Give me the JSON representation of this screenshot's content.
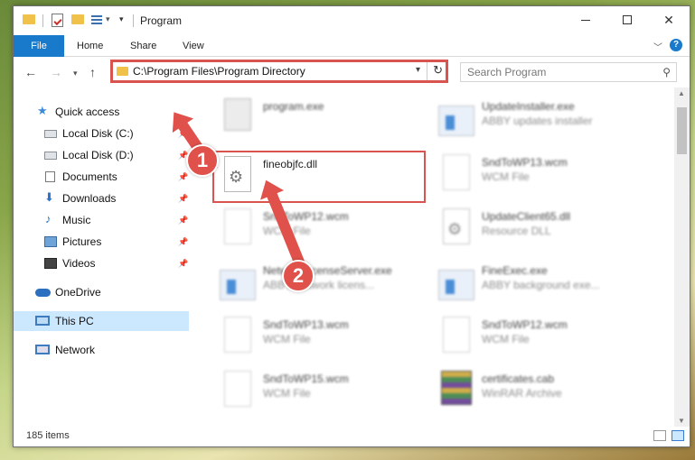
{
  "window": {
    "title": "Program",
    "minimize": "",
    "maximize": "",
    "close": "✕"
  },
  "ribbon": {
    "tabs": [
      "File",
      "Home",
      "Share",
      "View"
    ]
  },
  "address": {
    "path": "C:\\Program Files\\Program Directory",
    "search_placeholder": "Search Program"
  },
  "sidebar": {
    "items": [
      {
        "label": "Quick access",
        "icon": "star-icon",
        "pinned": false
      },
      {
        "label": "Local Disk (C:)",
        "icon": "disk-icon",
        "pinned": true
      },
      {
        "label": "Local Disk (D:)",
        "icon": "disk-icon",
        "pinned": true
      },
      {
        "label": "Documents",
        "icon": "document-icon",
        "pinned": true
      },
      {
        "label": "Downloads",
        "icon": "download-icon",
        "pinned": true
      },
      {
        "label": "Music",
        "icon": "music-icon",
        "pinned": true
      },
      {
        "label": "Pictures",
        "icon": "pictures-icon",
        "pinned": true
      },
      {
        "label": "Videos",
        "icon": "videos-icon",
        "pinned": true
      },
      {
        "label": "OneDrive",
        "icon": "cloud-icon",
        "pinned": false
      },
      {
        "label": "This PC",
        "icon": "computer-icon",
        "pinned": false,
        "selected": true
      },
      {
        "label": "Network",
        "icon": "network-icon",
        "pinned": false
      }
    ]
  },
  "files": [
    {
      "name": "program.exe",
      "type": "",
      "icon": "program-icon",
      "blurred": true
    },
    {
      "name": "UpdateInstaller.exe",
      "type": "ABBY updates installer",
      "icon": "app-icon",
      "blurred": true
    },
    {
      "name": "fineobjfc.dll",
      "type": "",
      "icon": "dll-gear-icon",
      "blurred": false,
      "highlighted": true
    },
    {
      "name": "SndToWP13.wcm",
      "type": "WCM File",
      "icon": "file-icon",
      "blurred": true
    },
    {
      "name": "SndToWP12.wcm",
      "type": "WCM File",
      "icon": "file-icon",
      "blurred": true
    },
    {
      "name": "UpdateClient65.dll",
      "type": "Resource DLL",
      "icon": "dll-gear-icon",
      "blurred": true
    },
    {
      "name": "NetworkLicenseServer.exe",
      "type": "ABBY Network licens...",
      "icon": "app-icon",
      "blurred": true
    },
    {
      "name": "FineExec.exe",
      "type": "ABBY background exe...",
      "icon": "app-icon",
      "blurred": true
    },
    {
      "name": "SndToWP13.wcm",
      "type": "WCM File",
      "icon": "file-icon",
      "blurred": true
    },
    {
      "name": "SndToWP12.wcm",
      "type": "WCM File",
      "icon": "file-icon",
      "blurred": true
    },
    {
      "name": "SndToWP15.wcm",
      "type": "WCM File",
      "icon": "file-icon",
      "blurred": true
    },
    {
      "name": "certificates.cab",
      "type": "WinRAR Archive",
      "icon": "archive-icon",
      "blurred": true
    }
  ],
  "status": {
    "item_count": "185 items"
  },
  "callouts": [
    "1",
    "2"
  ],
  "colors": {
    "accent": "#1979ca",
    "highlight": "#d9534f",
    "selection": "#cce8ff"
  }
}
